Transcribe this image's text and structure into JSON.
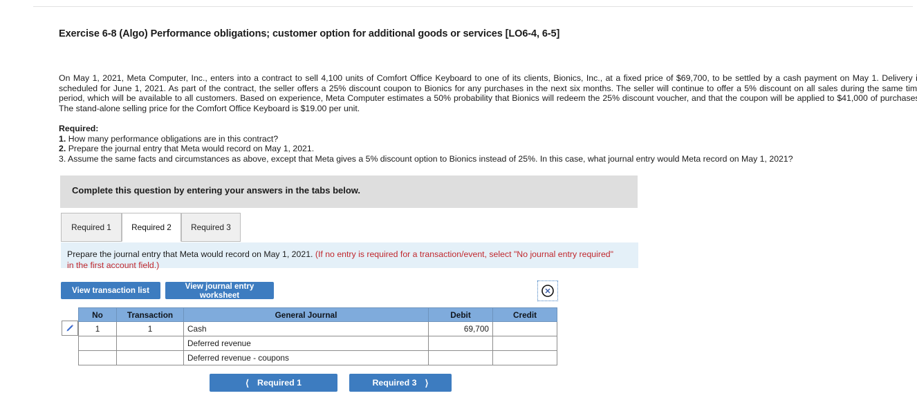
{
  "exercise": {
    "title": "Exercise 6-8 (Algo) Performance obligations; customer option for additional goods or services [LO6-4, 6-5]",
    "body": "On May 1, 2021, Meta Computer, Inc., enters into a contract to sell 4,100 units of Comfort Office Keyboard to one of its clients, Bionics, Inc., at a fixed price of $69,700, to be settled by a cash payment on May 1. Delivery is scheduled for June 1, 2021. As part of the contract, the seller offers a 25% discount coupon to Bionics for any purchases in the next six months. The seller will continue to offer a 5% discount on all sales during the same time period, which will be available to all customers. Based on experience, Meta Computer estimates a 50% probability that Bionics will redeem the 25% discount voucher, and that the coupon will be applied to $41,000 of purchases. The stand-alone selling price for the Comfort Office Keyboard is $19.00 per unit."
  },
  "required": {
    "heading": "Required:",
    "items": [
      {
        "num": "1.",
        "text": "How many performance obligations are in this contract?"
      },
      {
        "num": "2.",
        "text": "Prepare the journal entry that Meta would record on May 1, 2021."
      },
      {
        "num": "3.",
        "text": "Assume the same facts and circumstances as above, except that Meta gives a 5% discount option to Bionics instead of 25%. In this case, what journal entry would Meta record on May 1, 2021?"
      }
    ]
  },
  "banner": {
    "text": "Complete this question by entering your answers in the tabs below."
  },
  "tabs": [
    {
      "label": "Required 1",
      "active": false
    },
    {
      "label": "Required 2",
      "active": true
    },
    {
      "label": "Required 3",
      "active": false
    }
  ],
  "info": {
    "main": "Prepare the journal entry that Meta would record on May 1, 2021. ",
    "note": "(If no entry is required for a transaction/event, select \"No journal entry required\" in the first account field.)"
  },
  "toolbar": {
    "view_transaction_list": "View transaction list",
    "view_journal_entry_worksheet": "View journal entry worksheet",
    "close_icon": "circle-x-icon",
    "edit_icon": "pencil-icon"
  },
  "journal": {
    "columns": [
      "No",
      "Transaction",
      "General Journal",
      "Debit",
      "Credit"
    ],
    "rows": [
      {
        "no": "1",
        "transaction": "1",
        "account": "Cash",
        "indent": false,
        "debit": "69,700",
        "credit": ""
      },
      {
        "no": "",
        "transaction": "",
        "account": "Deferred revenue",
        "indent": false,
        "debit": "",
        "credit": ""
      },
      {
        "no": "",
        "transaction": "",
        "account": "Deferred revenue - coupons",
        "indent": true,
        "debit": "",
        "credit": ""
      }
    ]
  },
  "navigation": {
    "prev_label": "Required 1",
    "prev_icon": "chevron-left-icon",
    "next_label": "Required 3",
    "next_icon": "chevron-right-icon"
  },
  "colors": {
    "accent_blue": "#3d7cc0",
    "table_header_blue": "#7fabdc",
    "info_panel_blue": "#e4f0f8",
    "banner_gray": "#dedede",
    "note_red": "#c0272d",
    "value_maroon": "#7b1a26"
  }
}
